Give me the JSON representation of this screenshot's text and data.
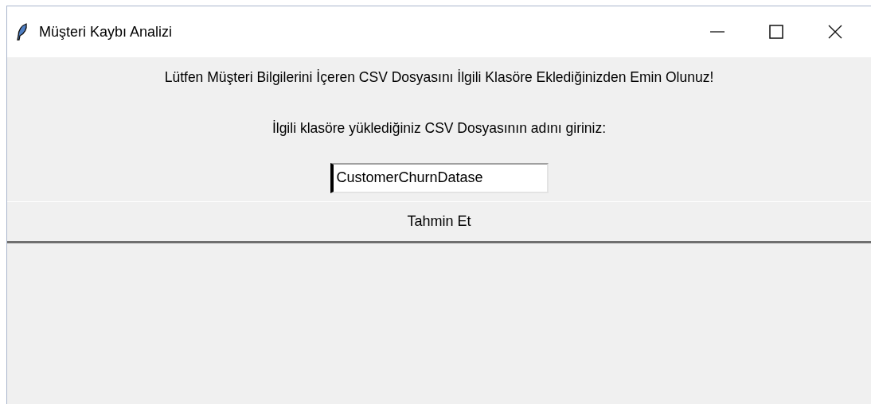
{
  "window": {
    "title": "Müşteri Kaybı Analizi"
  },
  "instruction": "Lütfen Müşteri Bilgilerini İçeren CSV Dosyasını İlgili Klasöre Eklediğinizden Emin Olunuz!",
  "prompt": "İlgili klasöre yüklediğiniz CSV Dosyasının adını giriniz:",
  "file_field": {
    "value": "CustomerChurnDatase"
  },
  "buttons": [
    "Tahmin Et"
  ]
}
